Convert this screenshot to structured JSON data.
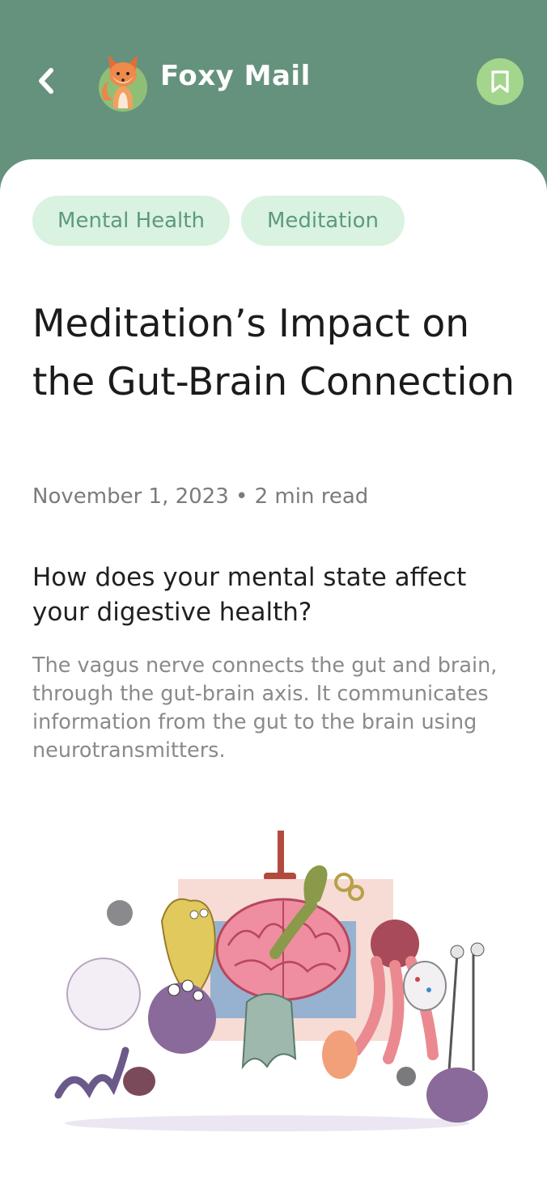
{
  "header": {
    "app_name": "Foxy Mail",
    "back_icon": "chevron-left-icon",
    "bookmark_icon": "bookmark-icon",
    "background_color": "#65927d",
    "bookmark_bg_color": "#a3d58c"
  },
  "tags": [
    "Mental Health",
    "Meditation"
  ],
  "article": {
    "title": "Meditation’s Impact on the Gut-Brain Connection",
    "meta": "November 1, 2023 • 2 min read",
    "subheading": "How does your mental state affect your digestive health?",
    "body": "The vagus nerve connects the gut and brain, through the gut-brain axis. It communicates information from the gut to the brain using neurotransmitters."
  },
  "colors": {
    "chip_bg": "#daf2e0",
    "chip_text": "#5c9a80",
    "title_text": "#1b1b1b",
    "meta_text": "#7b7b7b",
    "body_text": "#8a8a8a"
  }
}
